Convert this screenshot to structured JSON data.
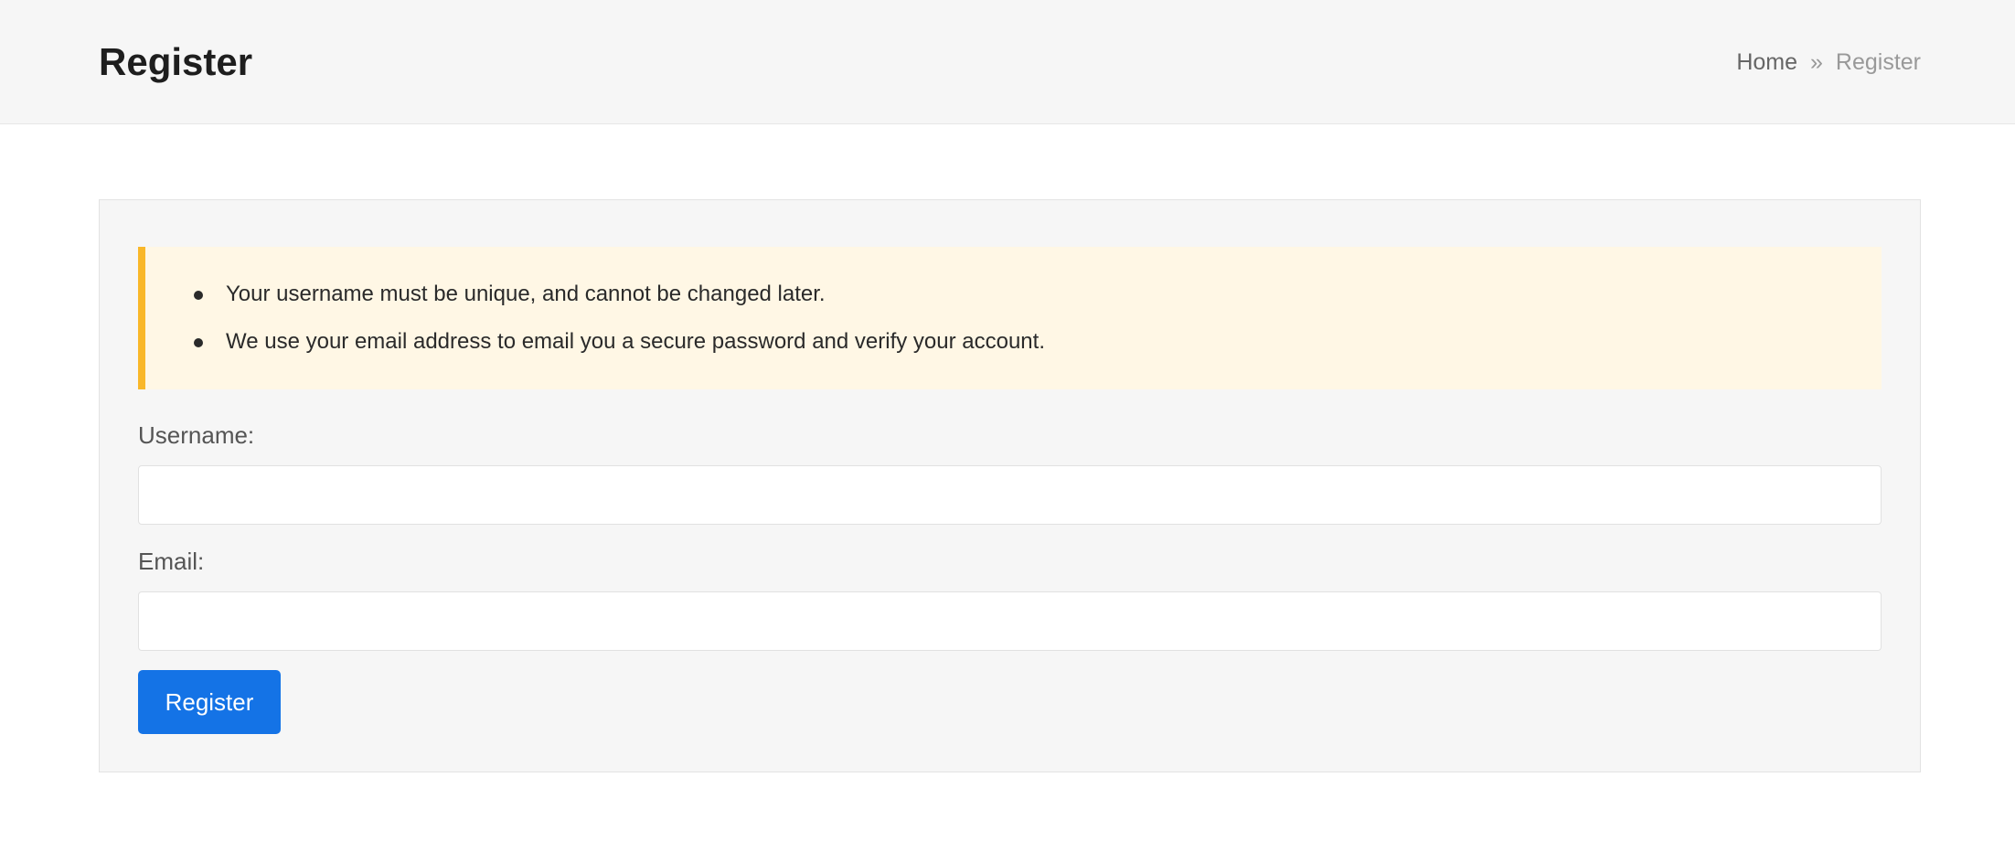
{
  "header": {
    "title": "Register",
    "breadcrumb": {
      "home": "Home",
      "separator": "»",
      "current": "Register"
    }
  },
  "notice": {
    "accent_color": "#f9b729",
    "background_color": "#fff7e5",
    "items": [
      "Your username must be unique, and cannot be changed later.",
      "We use your email address to email you a secure password and verify your account."
    ]
  },
  "form": {
    "username": {
      "label": "Username:",
      "value": "",
      "placeholder": ""
    },
    "email": {
      "label": "Email:",
      "value": "",
      "placeholder": ""
    },
    "submit_label": "Register",
    "submit_color": "#1473e6"
  }
}
